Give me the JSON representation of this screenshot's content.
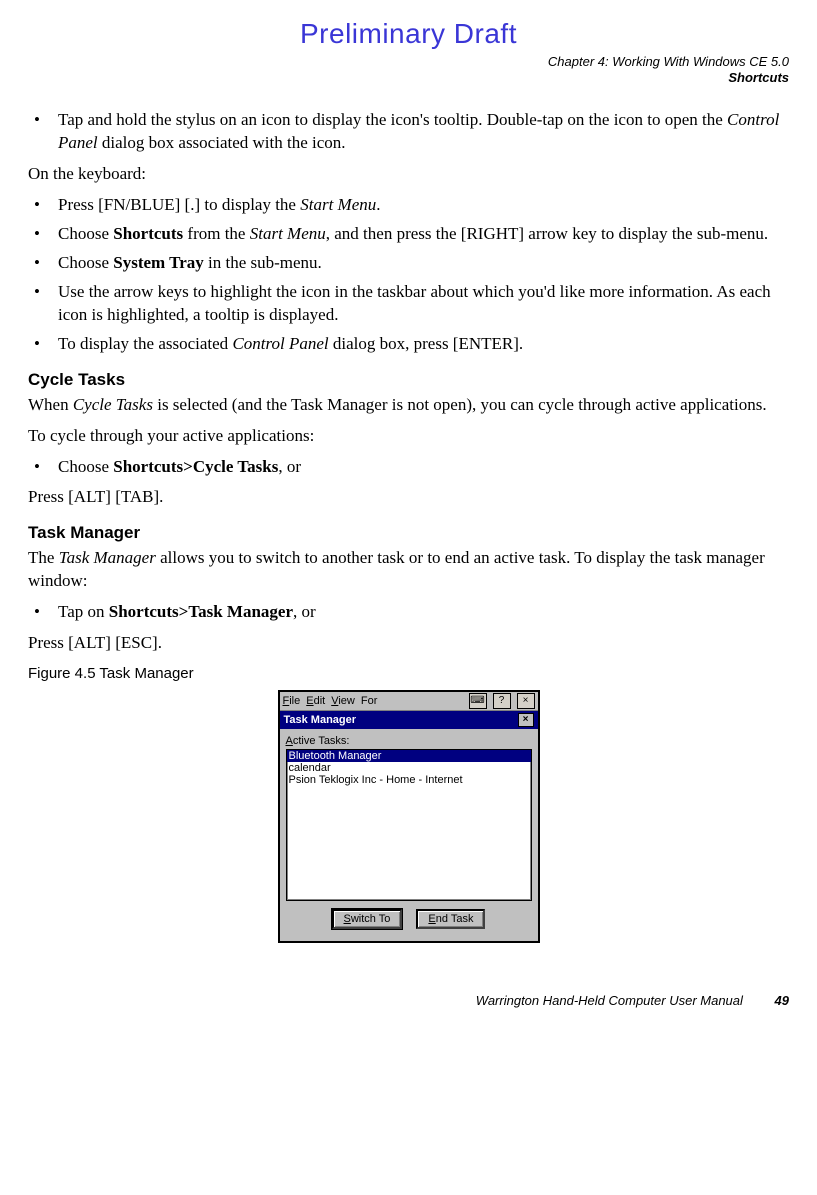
{
  "draft_banner": "Preliminary Draft",
  "header_line1": "Chapter 4:  Working With Windows CE 5.0",
  "header_line2": "Shortcuts",
  "li1a": "Tap and hold the stylus on an icon to display the icon's tooltip. Double-tap on the icon to open the ",
  "li1b": "Control Panel",
  "li1c": " dialog box associated with the icon.",
  "p_onkb": "On the keyboard:",
  "li2a": "Press [FN/BLUE] [.] to display the ",
  "li2b": "Start Menu",
  "li2c": ".",
  "li3a": "Choose ",
  "li3b": "Shortcuts",
  "li3c": " from the ",
  "li3d": "Start Menu",
  "li3e": ", and then press the [RIGHT] arrow key to display the sub-menu.",
  "li4a": "Choose ",
  "li4b": "System Tray",
  "li4c": " in the sub-menu.",
  "li5": "Use the arrow keys to highlight the icon in the taskbar about which you'd like more information. As each icon is highlighted, a tooltip is displayed.",
  "li6a": "To display the associated ",
  "li6b": "Control Panel",
  "li6c": " dialog box, press [ENTER].",
  "h_cycle": "Cycle Tasks",
  "p_cycle_a": "When ",
  "p_cycle_b": "Cycle Tasks",
  "p_cycle_c": " is selected (and the Task Manager is not open), you can cycle through active applications.",
  "p_cycle2": "To cycle through your active applications:",
  "li7a": "Choose ",
  "li7b": "Shortcuts>Cycle Tasks",
  "li7c": ", or",
  "p_alt_tab": "Press [ALT] [TAB].",
  "h_tm": "Task Manager",
  "p_tm_a": "The ",
  "p_tm_b": "Task Manager",
  "p_tm_c": " allows you to switch to another task or to end an active task. To display the task manager window:",
  "li8a": "Tap on ",
  "li8b": "Shortcuts>Task Manager",
  "li8c": ", or",
  "p_alt_esc": "Press [ALT] [ESC].",
  "fig_cap": "Figure 4.5  Task Manager",
  "win": {
    "menu_file_u": "F",
    "menu_file_r": "ile",
    "menu_edit_u": "E",
    "menu_edit_r": "dit",
    "menu_view_u": "V",
    "menu_view_r": "iew",
    "menu_font_u": "",
    "menu_font_r": "For",
    "kb_icon": "⌨",
    "help_icon": "?",
    "close_icon": "×",
    "title": "Task Manager",
    "title_close": "×",
    "active_label_u": "A",
    "active_label_r": "ctive Tasks:",
    "items": [
      "Bluetooth Manager",
      "calendar",
      "Psion Teklogix Inc   - Home - Internet"
    ],
    "switch_u": "S",
    "switch_r": "witch To",
    "end_u": "E",
    "end_r": "nd Task"
  },
  "footer_text": "Warrington Hand-Held Computer User Manual",
  "page_num": "49"
}
